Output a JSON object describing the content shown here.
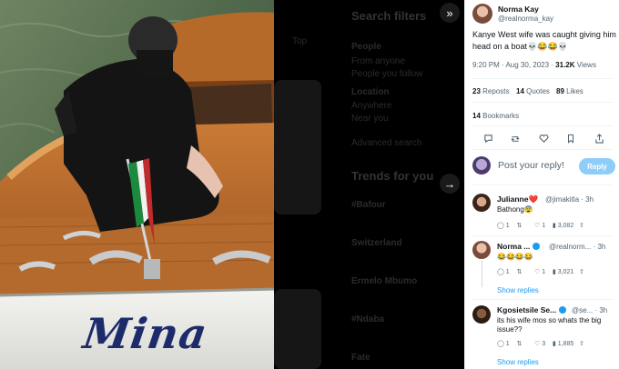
{
  "viewer": {
    "close_icon": "»",
    "next_icon": "→"
  },
  "photo": {
    "boat_name": "Mina"
  },
  "background_page": {
    "search_filters": "Search filters",
    "people": "People",
    "from_anyone": "From anyone",
    "people_you_follow": "People you follow",
    "location": "Location",
    "anywhere": "Anywhere",
    "near_you": "Near you",
    "advanced_search": "Advanced search",
    "trends_for_you": "Trends for you",
    "trends": [
      "#Bafour",
      "Switzerland",
      "Ermelo Mbumo",
      "#Ndaba",
      "Fate"
    ],
    "top_label": "Top"
  },
  "tweet": {
    "author_name": "Norma Kay",
    "author_handle": "@realnorma_kay",
    "text": "Kanye West wife was caught giving him head on a boat💀😂😂💀",
    "time": "9:20 PM · Aug 30, 2023 · ",
    "views_count": "31.2K",
    "views_label": " Views",
    "reposts_count": "23",
    "reposts_label": " Reposts",
    "quotes_count": "14",
    "quotes_label": " Quotes",
    "likes_count": "89",
    "likes_label": " Likes",
    "bookmarks_count": "14",
    "bookmarks_label": " Bookmarks"
  },
  "composer": {
    "placeholder": "Post your reply!",
    "reply_label": "Reply"
  },
  "replies": [
    {
      "name": "Julianne❤️",
      "handle": "@jimakitla · 3h",
      "text": "Bathong😨",
      "replies": "1",
      "reposts": "",
      "likes": "1",
      "views": "3,082"
    },
    {
      "name": "Norma ...",
      "handle": "@realnorm... · 3h",
      "text": "😂😂😂😂",
      "replies": "1",
      "reposts": "",
      "likes": "1",
      "views": "3,021",
      "show_replies": "Show replies"
    },
    {
      "name": "Kgosietsile Se...",
      "handle": "@se... · 3h",
      "text_line1": "its his wife mos so whats the big",
      "text_line2": "issue??",
      "replies": "1",
      "reposts": "",
      "likes": "3",
      "views": "1,885",
      "show_replies": "Show replies"
    }
  ],
  "colors": {
    "accent": "#1d9bf0",
    "reply_button": "#8ecdf8",
    "boat_wood": "#b86a2c",
    "water": "#4f6a4a"
  }
}
